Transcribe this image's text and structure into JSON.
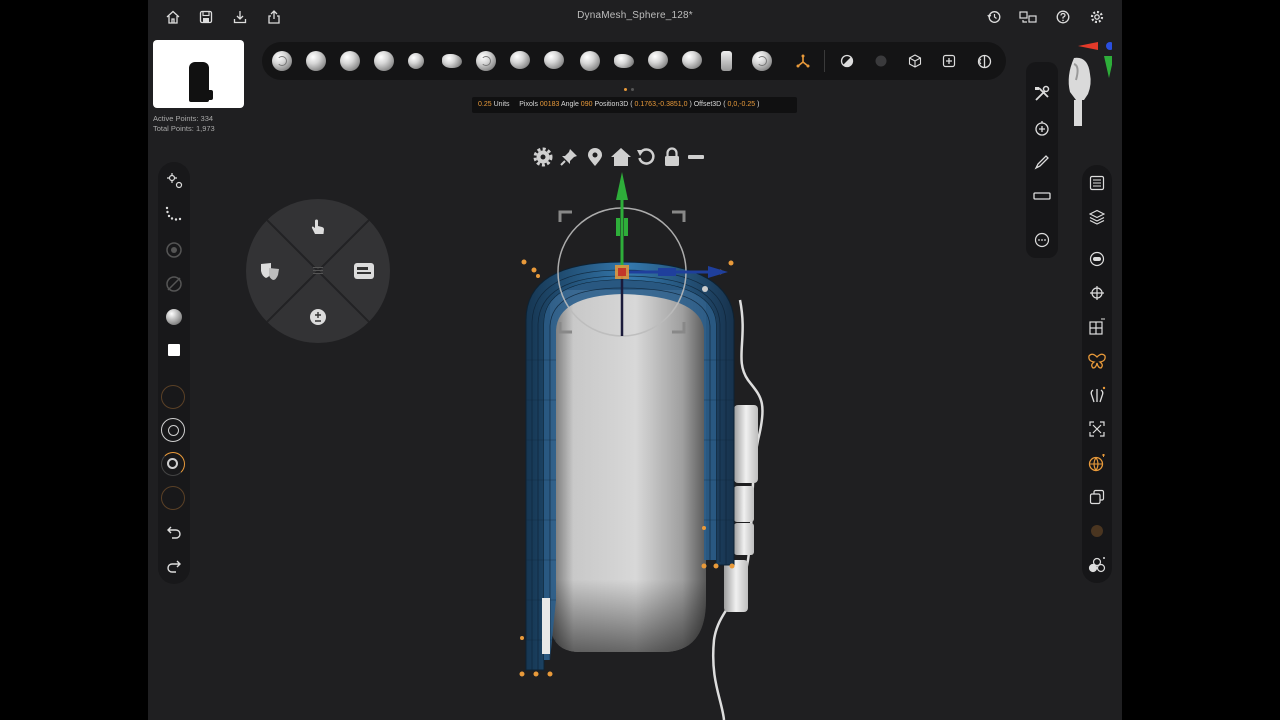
{
  "document": {
    "title": "DynaMesh_Sphere_128*"
  },
  "top_bar": {
    "left_icons": [
      "home-icon",
      "save-icon",
      "import-icon",
      "share-icon"
    ],
    "right_icons": [
      "history-icon",
      "layout-icon",
      "help-icon",
      "settings-icon"
    ]
  },
  "mesh_stats": {
    "active_points": "Active Points: 334",
    "total_points": "Total Points: 1,973"
  },
  "brush_shelf": {
    "brushes": [
      "clay-buildup",
      "clay",
      "standard",
      "move",
      "smooth",
      "dam-standard",
      "inflate",
      "pinch",
      "trim-dynamic",
      "polish",
      "flatten",
      "hpolish",
      "character",
      "snake-hook"
    ],
    "tools": [
      "gizmo-icon",
      "material-icon",
      "color-icon",
      "cube-icon",
      "add-icon",
      "symmetry-icon"
    ]
  },
  "info_bar": {
    "units_value": "0.25",
    "units_label": "Units",
    "pixels_label": "Pixols",
    "pixels_value": "00183",
    "angle_label": "Angle",
    "angle_value": "090",
    "position_label": "Position3D",
    "position_open": "(",
    "position_value": "0.1763,-0.3851,0",
    "position_close": ")",
    "offset_label": "Offset3D",
    "offset_open": "(",
    "offset_value": "0,0,-0.25",
    "offset_close": ")"
  },
  "gizmo_toolbar": [
    "gear-icon",
    "pin-icon",
    "location-icon",
    "home-icon",
    "reset-icon",
    "lock-icon",
    "minus-icon"
  ],
  "left_toolbar": [
    "transform-icon",
    "stroke-icon",
    "mask-icon",
    "hide-icon",
    "material-sphere-icon",
    "color-swatch-icon",
    "brush-size-ring",
    "focal-ring",
    "intensity-ring",
    "draw-ring",
    "undo-icon",
    "redo-icon"
  ],
  "radial_menu": [
    "touch-icon",
    "masks-icon",
    "panel-icon",
    "plus-minus-icon",
    "center-grid-icon"
  ],
  "right_toolbar_top": [
    "tools-icon",
    "subtool-add-icon",
    "brush-pen-icon",
    "ruler-icon",
    "more-icon"
  ],
  "right_toolbar_side": [
    "list-icon",
    "layers-icon",
    "dynamesh-icon",
    "crosshair-icon",
    "xyz-grid-icon",
    "butterfly-icon",
    "symmetry-figure-icon",
    "expand-icon",
    "globe-icon",
    "duplicate-icon",
    "material-icon",
    "spheres-icon"
  ],
  "colors": {
    "accent": "#e99a3a",
    "background": "#1f1f21",
    "axis_x": "#2a5fbf",
    "axis_y": "#2eae3a",
    "mesh_highlight": "#2f6a9b"
  }
}
